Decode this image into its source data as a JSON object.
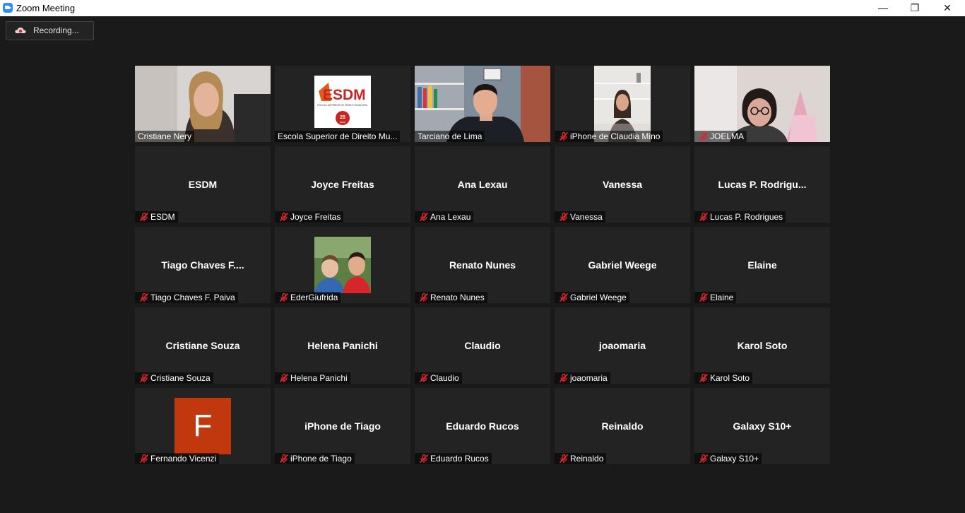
{
  "window": {
    "title": "Zoom Meeting",
    "minimize": "—",
    "restore": "❐",
    "close": "✕"
  },
  "recording": {
    "label": "Recording..."
  },
  "colors": {
    "active_speaker": "#dfe58b",
    "mic_muted": "#e0262b",
    "tile_bg": "#232323"
  },
  "tiles": [
    {
      "name": "Cristiane Nery",
      "display": "",
      "muted": false,
      "video": "woman-office"
    },
    {
      "name": "Escola Superior de Direito Mu...",
      "display": "",
      "muted": false,
      "video": "esdm-logo",
      "logo": {
        "title": "ESDM",
        "subtitle": "ESCOLA SUPERIOR DE DIREITO MUNICIPAL",
        "badge": "25",
        "badge_sub": "anos"
      }
    },
    {
      "name": "Tarciano de Lima",
      "display": "",
      "muted": false,
      "video": "man-bookshelf",
      "active": true
    },
    {
      "name": "iPhone de Claudia Mino",
      "display": "",
      "muted": true,
      "video": "woman-room"
    },
    {
      "name": "JOELMA",
      "display": "",
      "muted": true,
      "video": "woman-glasses"
    },
    {
      "name": "ESDM",
      "display": "ESDM",
      "muted": true
    },
    {
      "name": "Joyce Freitas",
      "display": "Joyce Freitas",
      "muted": true
    },
    {
      "name": "Ana Lexau",
      "display": "Ana Lexau",
      "muted": true
    },
    {
      "name": "Vanessa",
      "display": "Vanessa",
      "muted": true
    },
    {
      "name": "Lucas P. Rodrigues",
      "display": "Lucas  P.  Rodrigu...",
      "muted": true
    },
    {
      "name": "Tiago Chaves F. Paiva",
      "display": "Tiago  Chaves  F....",
      "muted": true
    },
    {
      "name": "EderGiufrida",
      "display": "",
      "muted": true,
      "video": "father-son"
    },
    {
      "name": "Renato Nunes",
      "display": "Renato Nunes",
      "muted": true
    },
    {
      "name": "Gabriel Weege",
      "display": "Gabriel Weege",
      "muted": true
    },
    {
      "name": "Elaine",
      "display": "Elaine",
      "muted": true
    },
    {
      "name": "Cristiane Souza",
      "display": "Cristiane Souza",
      "muted": true
    },
    {
      "name": "Helena Panichi",
      "display": "Helena Panichi",
      "muted": true
    },
    {
      "name": "Claudio",
      "display": "Claudio",
      "muted": true
    },
    {
      "name": "joaomaria",
      "display": "joaomaria",
      "muted": true
    },
    {
      "name": "Karol Soto",
      "display": "Karol Soto",
      "muted": true
    },
    {
      "name": "Fernando Vicenzi",
      "display": "",
      "muted": true,
      "video": "avatar-letter",
      "avatar": {
        "letter": "F",
        "color": "#c1380f"
      }
    },
    {
      "name": "iPhone de Tiago",
      "display": "iPhone de Tiago",
      "muted": true
    },
    {
      "name": "Eduardo Rucos",
      "display": "Eduardo Rucos",
      "muted": true
    },
    {
      "name": "Reinaldo",
      "display": "Reinaldo",
      "muted": true
    },
    {
      "name": "Galaxy S10+",
      "display": "Galaxy S10+",
      "muted": true
    }
  ]
}
